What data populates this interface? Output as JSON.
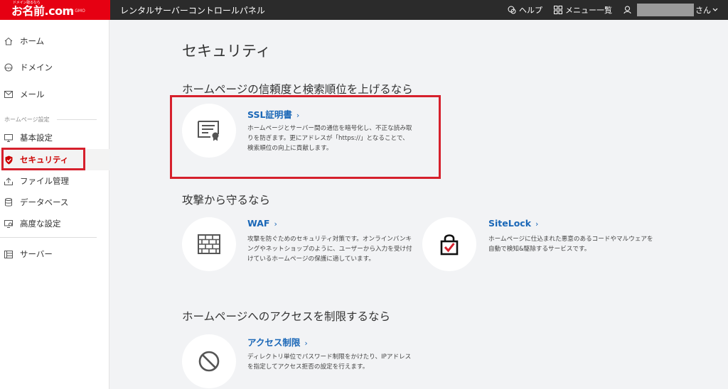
{
  "header": {
    "logo_tagline": "ドメイン取るなら",
    "logo_text": "お名前.com",
    "logo_sub": "by GMO",
    "app_title": "レンタルサーバーコントロールパネル",
    "help_label": "ヘルプ",
    "menu_label": "メニュー一覧",
    "user_suffix": "さん"
  },
  "sidebar": {
    "items": [
      {
        "label": "ホーム",
        "icon": "home-icon"
      },
      {
        "label": "ドメイン",
        "icon": "www-icon"
      },
      {
        "label": "メール",
        "icon": "mail-icon"
      }
    ],
    "section_heading": "ホームページ設定",
    "hp_items": [
      {
        "label": "基本設定",
        "icon": "monitor-icon"
      },
      {
        "label": "セキュリティ",
        "icon": "shield-icon",
        "active": true
      },
      {
        "label": "ファイル管理",
        "icon": "upload-icon"
      },
      {
        "label": "データベース",
        "icon": "database-icon"
      },
      {
        "label": "高度な設定",
        "icon": "monitor-gear-icon"
      }
    ],
    "server_item": {
      "label": "サーバー",
      "icon": "server-icon"
    }
  },
  "main": {
    "title": "セキュリティ",
    "sections": [
      {
        "heading": "ホームページの信頼度と検索順位を上げるなら",
        "cards": [
          {
            "title": "SSL証明書",
            "chevron": "›",
            "icon": "certificate-icon",
            "desc": "ホームページとサーバー間の通信を暗号化し、不正な読み取りを防ぎます。更にアドレスが「https://」となることで、検索順位の向上に貢献します。"
          }
        ]
      },
      {
        "heading": "攻撃から守るなら",
        "cards": [
          {
            "title": "WAF",
            "chevron": "›",
            "icon": "firewall-icon",
            "desc": "攻撃を防ぐためのセキュリティ対策です。オンラインバンキングやネットショップのように、ユーザーから入力を受け付けているホームページの保護に適しています。"
          },
          {
            "title": "SiteLock",
            "chevron": "›",
            "icon": "lock-check-icon",
            "desc": "ホームページに仕込まれた悪意のあるコードやマルウェアを自動で検知&駆除するサービスです。"
          }
        ]
      },
      {
        "heading": "ホームページへのアクセスを制限するなら",
        "cards": [
          {
            "title": "アクセス制限",
            "chevron": "›",
            "icon": "prohibited-icon",
            "desc": "ディレクトリ単位でパスワード制限をかけたり、IPアドレスを指定してアクセス拒否の設定を行えます。"
          }
        ]
      }
    ]
  },
  "colors": {
    "brand_red": "#e60012",
    "topbar_bg": "#2b2b2b",
    "link_blue": "#1a67b7",
    "highlight_red": "#d6202c"
  }
}
